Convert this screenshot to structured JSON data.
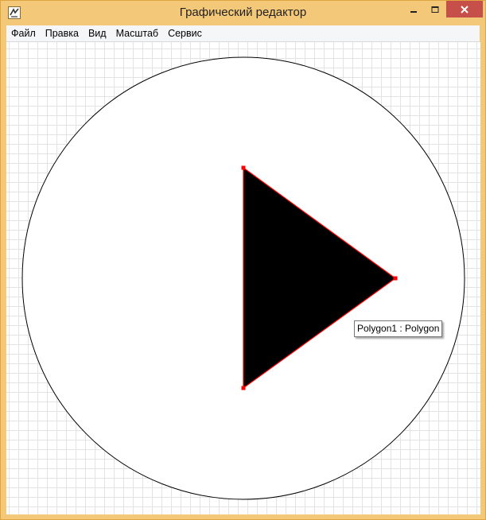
{
  "window": {
    "title": "Графический редактор",
    "frame_color": "#f4c879",
    "close_color": "#c74f4a"
  },
  "menu": {
    "items": [
      "Файл",
      "Правка",
      "Вид",
      "Масштаб",
      "Сервис"
    ]
  },
  "canvas": {
    "grid_visible": true,
    "grid_color": "#e3e3e3",
    "shapes": {
      "circle": {
        "stroke": "#000000",
        "fill": "#ffffff"
      },
      "polygon": {
        "name": "Polygon1",
        "fill": "#000000",
        "stroke": "#ff0000",
        "selected": true
      }
    },
    "tooltip": "Polygon1 : Polygon"
  }
}
